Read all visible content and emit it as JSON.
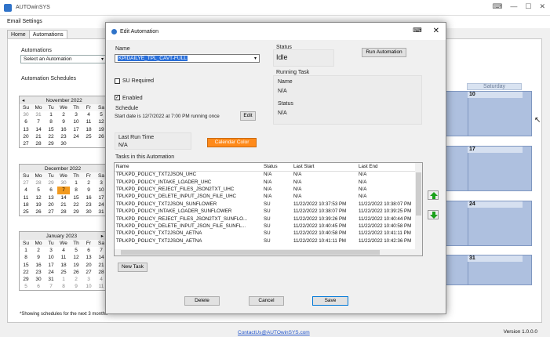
{
  "app": {
    "title": "AUTOwinSYS"
  },
  "menu": {
    "email_settings": "Email Settings"
  },
  "tabs": [
    {
      "label": "Home"
    },
    {
      "label": "Automations"
    }
  ],
  "main": {
    "automations_label": "Automations",
    "select_placeholder": "Select an Automation",
    "schedules_label": "Automation Schedules",
    "footnote": "*Showing schedules for the next 3 months",
    "contact_link": "ContactUs@AUTOwinSYS.com",
    "version": "Version 1.0.0.0"
  },
  "mini_calendars": [
    {
      "month": "November 2022",
      "dow": [
        "Su",
        "Mo",
        "Tu",
        "We",
        "Th",
        "Fr",
        "Sa"
      ],
      "days": [
        [
          "30",
          "31",
          "1",
          "2",
          "3",
          "4",
          "5"
        ],
        [
          "6",
          "7",
          "8",
          "9",
          "10",
          "11",
          "12"
        ],
        [
          "13",
          "14",
          "15",
          "16",
          "17",
          "18",
          "19"
        ],
        [
          "20",
          "21",
          "22",
          "23",
          "24",
          "25",
          "26"
        ],
        [
          "27",
          "28",
          "29",
          "30",
          "",
          "",
          " "
        ]
      ]
    },
    {
      "month": "December 2022",
      "dow": [
        "Su",
        "Mo",
        "Tu",
        "We",
        "Th",
        "Fr",
        "Sa"
      ],
      "days": [
        [
          "27",
          "28",
          "29",
          "30",
          "1",
          "2",
          "3"
        ],
        [
          "4",
          "5",
          "6",
          "7",
          "8",
          "9",
          "10"
        ],
        [
          "11",
          "12",
          "13",
          "14",
          "15",
          "16",
          "17"
        ],
        [
          "18",
          "19",
          "20",
          "21",
          "22",
          "23",
          "24"
        ],
        [
          "25",
          "26",
          "27",
          "28",
          "29",
          "30",
          "31"
        ]
      ]
    },
    {
      "month": "January 2023",
      "dow": [
        "Su",
        "Mo",
        "Tu",
        "We",
        "Th",
        "Fr",
        "Sa"
      ],
      "days": [
        [
          "1",
          "2",
          "3",
          "4",
          "5",
          "6",
          "7"
        ],
        [
          "8",
          "9",
          "10",
          "11",
          "12",
          "13",
          "14"
        ],
        [
          "15",
          "16",
          "17",
          "18",
          "19",
          "20",
          "21"
        ],
        [
          "22",
          "23",
          "24",
          "25",
          "26",
          "27",
          "28"
        ],
        [
          "29",
          "30",
          "31",
          "1",
          "2",
          "3",
          "4"
        ],
        [
          "5",
          "6",
          "7",
          "8",
          "9",
          "10",
          "11"
        ]
      ]
    }
  ],
  "big_calendar": {
    "day_header": "Saturday",
    "week_numbers": [
      "10",
      "17",
      "24",
      "31"
    ]
  },
  "dialog": {
    "title": "Edit Automation",
    "name_label": "Name",
    "name_value": "KPIDAILYE_TPL_CAVT-FULL",
    "status_label": "Status",
    "status_value": "Idle",
    "run_button": "Run Automation",
    "su_required_label": "SU Required",
    "enabled_label": "Enabled",
    "running_task_label": "Running Task",
    "rt_name_label": "Name",
    "rt_name_value": "N/A",
    "rt_status_label": "Status",
    "rt_status_value": "N/A",
    "schedule_label": "Schedule",
    "schedule_text": "Start date is 12/7/2022 at 7:00 PM running once",
    "edit_button": "Edit",
    "last_run_label": "Last Run Time",
    "last_run_value": "N/A",
    "calendar_color_button": "Calendar Color",
    "tasks_label": "Tasks in this Automation",
    "task_columns": [
      "Name",
      "Status",
      "Last Start",
      "Last End"
    ],
    "tasks": [
      [
        "TPLKPD_POLICY_TXT2JSON_UHC",
        "N/A",
        "N/A",
        "N/A"
      ],
      [
        "TPLKPD_POLICY_INTAKE_LOADER_UHC",
        "N/A",
        "N/A",
        "N/A"
      ],
      [
        "TPLKPD_POLICY_REJECT_FILES_JSON2TXT_UHC",
        "N/A",
        "N/A",
        "N/A"
      ],
      [
        "TPLKPD_POLICY_DELETE_INPUT_JSON_FILE_UHC",
        "N/A",
        "N/A",
        "N/A"
      ],
      [
        "TPLKPD_POLICY_TXT2JSON_SUNFLOWER",
        "SU",
        "11/22/2022 10:37:53 PM",
        "11/22/2022 10:38:07 PM"
      ],
      [
        "TPLKPD_POLICY_INTAKE_LOADER_SUNFLOWER",
        "SU",
        "11/22/2022 10:38:07 PM",
        "11/22/2022 10:39:25 PM"
      ],
      [
        "TPLKPD_POLICY_REJECT_FILES_JSON2TXT_SUNFLO...",
        "SU",
        "11/22/2022 10:39:26 PM",
        "11/22/2022 10:40:44 PM"
      ],
      [
        "TPLKPD_POLICY_DELETE_INPUT_JSON_FILE_SUNFL...",
        "SU",
        "11/22/2022 10:40:45 PM",
        "11/22/2022 10:40:58 PM"
      ],
      [
        "TPLKPD_POLICY_TXT2JSON_AETNA",
        "SU",
        "11/22/2022 10:40:58 PM",
        "11/22/2022 10:41:11 PM"
      ],
      [
        "TPLKPD_POLICY_TXT2JSON_AETNA",
        "SU",
        "11/22/2022 10:41:11 PM",
        "11/22/2022 10:42:36 PM"
      ]
    ],
    "new_task_button": "New Task",
    "delete_button": "Delete",
    "cancel_button": "Cancel",
    "save_button": "Save"
  },
  "colors": {
    "accent": "#2a6fd9",
    "calendar_fill": "#aec0df",
    "highlight": "#f29a1f",
    "calendar_color_button": "#ff8a1a",
    "arrow": "#1aa01a"
  }
}
